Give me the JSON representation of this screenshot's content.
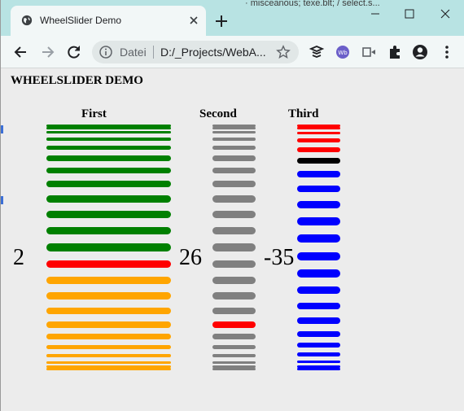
{
  "browser": {
    "tab_title": "WheelSlider Demo",
    "background_text": "· misceanous; texe.blt; / select.s...",
    "address_scheme": "Datei",
    "address_url": "D:/_Projects/WebA...",
    "colors": {
      "titlebar": "#b8e3e3",
      "toolbar": "#f2f7f7",
      "omnibox": "#e1e7e7"
    }
  },
  "page": {
    "title": "WHEELSLIDER DEMO",
    "sliders": [
      {
        "label": "First",
        "value": "2",
        "colors": {
          "above": "#008000",
          "selected": "#ff0000",
          "below": "#ffa500"
        }
      },
      {
        "label": "Second",
        "value": "26",
        "colors": {
          "above": "#808080",
          "selected": "#ff0000",
          "below": "#808080"
        }
      },
      {
        "label": "Third",
        "value": "-35",
        "colors": {
          "above": "#ff0000",
          "selected": "#000000",
          "below": "#0000ff"
        }
      }
    ]
  }
}
